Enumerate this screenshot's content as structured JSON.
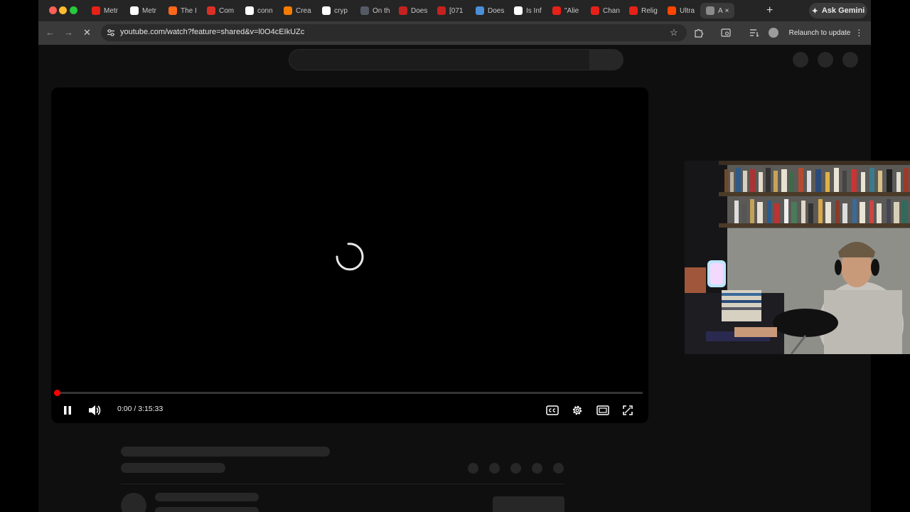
{
  "browser": {
    "tabs": [
      {
        "label": "Metr",
        "icon": "youtube-icon",
        "color": "#e62117"
      },
      {
        "label": "Metr",
        "icon": "wikipedia-icon",
        "color": "#ffffff"
      },
      {
        "label": "The I",
        "icon": "substack-icon",
        "color": "#ff6719"
      },
      {
        "label": "Com",
        "icon": "app-icon",
        "color": "#d93025"
      },
      {
        "label": "conn",
        "icon": "google-icon",
        "color": "#ffffff"
      },
      {
        "label": "Crea",
        "icon": "blogger-icon",
        "color": "#f57c00"
      },
      {
        "label": "cryp",
        "icon": "google-icon",
        "color": "#ffffff"
      },
      {
        "label": "On th",
        "icon": "page-icon",
        "color": "#555a66"
      },
      {
        "label": "Does",
        "icon": "gmail-icon",
        "color": "#c5221f"
      },
      {
        "label": "[071",
        "icon": "x-icon",
        "color": "#c5221f"
      },
      {
        "label": "Does",
        "icon": "docs-icon",
        "color": "#4a8fd8"
      },
      {
        "label": "Is Inf",
        "icon": "shirt-icon",
        "color": "#ffffff"
      },
      {
        "label": "\"Alie",
        "icon": "youtube-icon",
        "color": "#e62117"
      },
      {
        "label": "Chan",
        "icon": "youtube-icon",
        "color": "#e62117"
      },
      {
        "label": "Relig",
        "icon": "youtube-icon",
        "color": "#e62117"
      },
      {
        "label": "Ultra",
        "icon": "reddit-icon",
        "color": "#ff4500"
      },
      {
        "label": "A",
        "icon": "link-icon",
        "color": "#8a8a8a",
        "active": true
      }
    ],
    "new_tab": "+",
    "close_tab": "×",
    "gemini_label": "Ask Gemini",
    "url": "youtube.com/watch?feature=shared&v=l0O4cEIkUZc",
    "relaunch_label": "Relaunch to update"
  },
  "player": {
    "current_time": "0:00 / 3:15:33",
    "progress": 0,
    "state": "loading"
  },
  "colors": {
    "accent": "#ff0000",
    "page_bg": "#0f0f0f",
    "skeleton": "#272727"
  }
}
